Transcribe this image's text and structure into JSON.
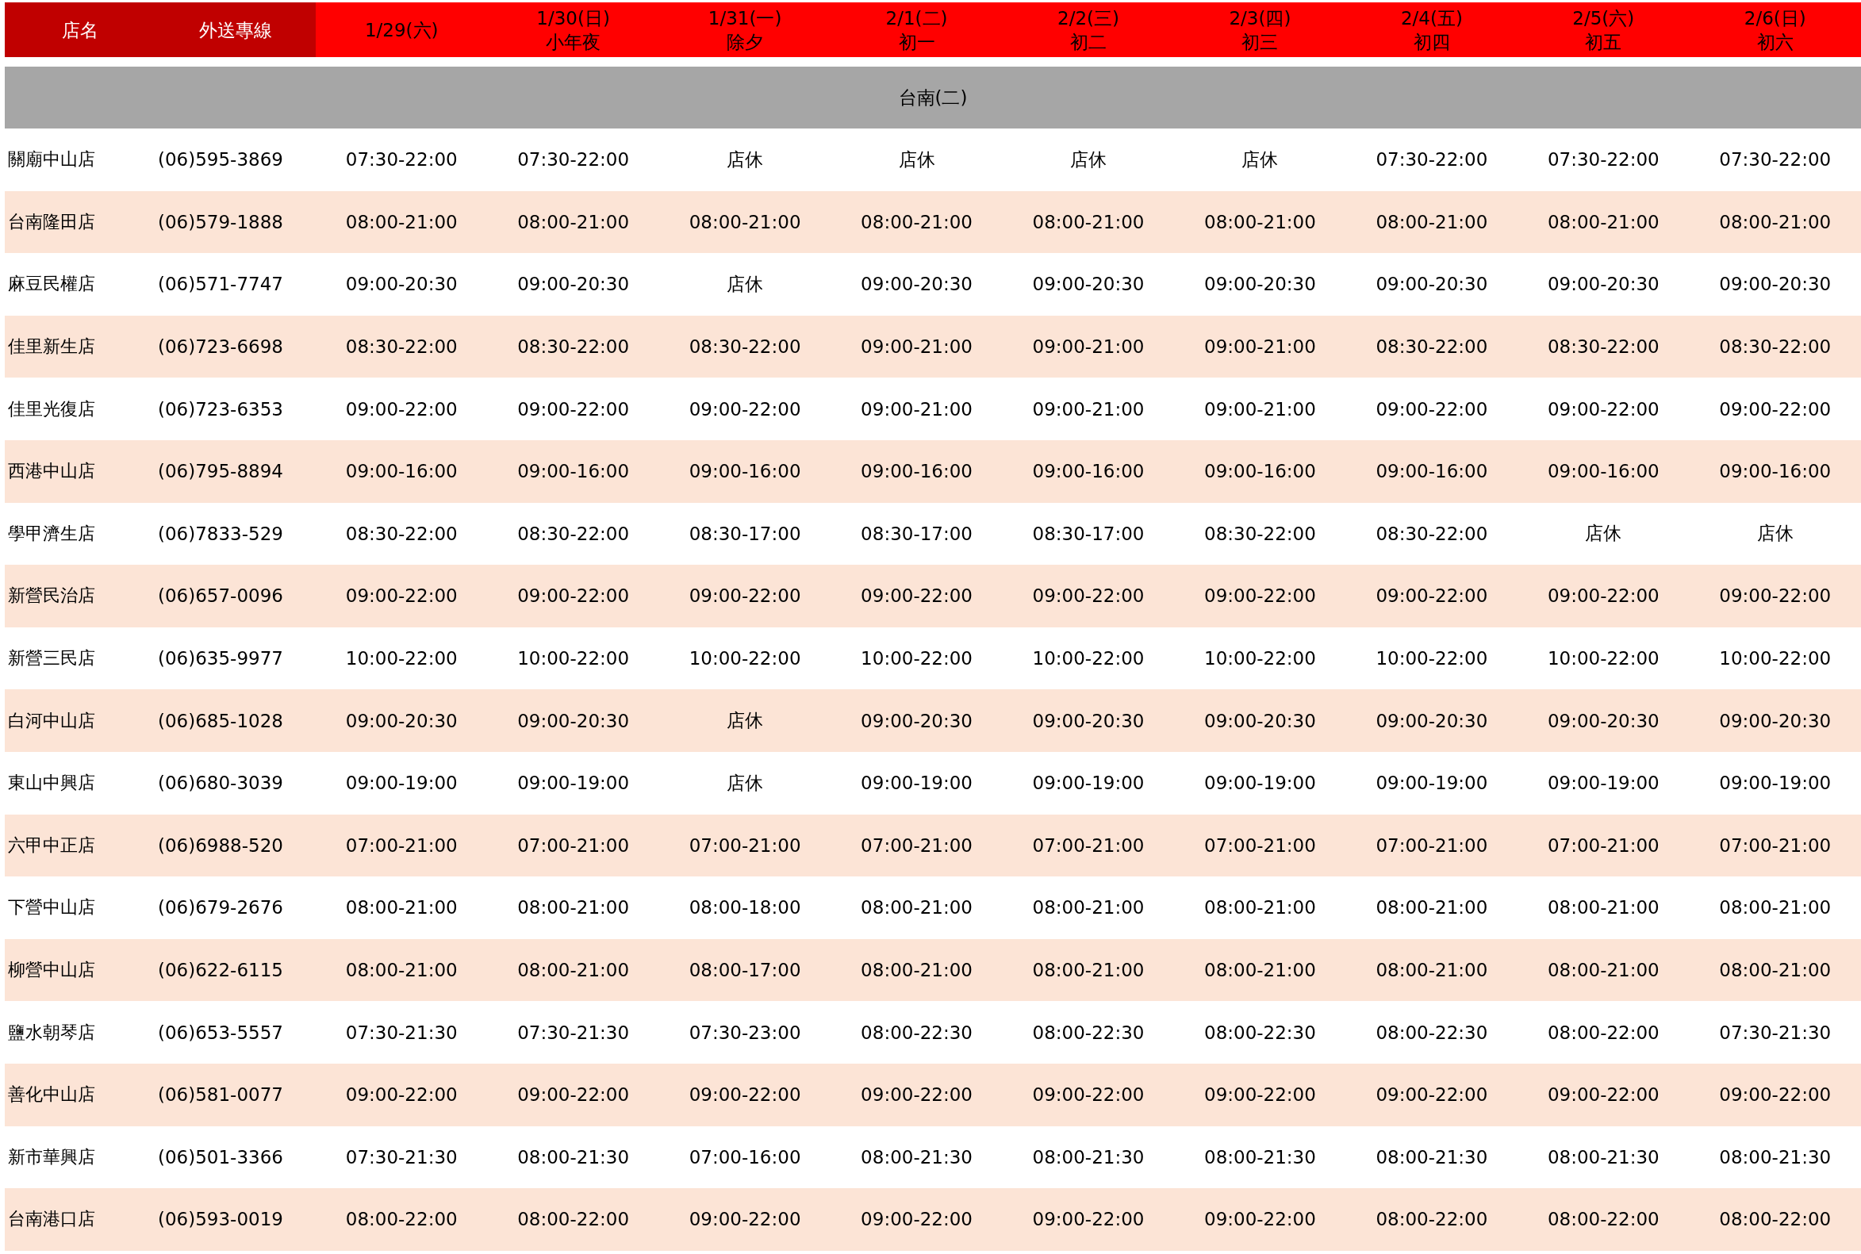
{
  "columns": [
    {
      "date": "店名"
    },
    {
      "date": "外送專線"
    },
    {
      "date": "1/29(六)"
    },
    {
      "date": "1/30(日)",
      "note": "小年夜"
    },
    {
      "date": "1/31(一)",
      "note": "除夕"
    },
    {
      "date": "2/1(二)",
      "note": "初一"
    },
    {
      "date": "2/2(三)",
      "note": "初二"
    },
    {
      "date": "2/3(四)",
      "note": "初三"
    },
    {
      "date": "2/4(五)",
      "note": "初四"
    },
    {
      "date": "2/5(六)",
      "note": "初五"
    },
    {
      "date": "2/6(日)",
      "note": "初六"
    }
  ],
  "region": "台南(二)",
  "rows": [
    {
      "name": "關廟中山店",
      "phone": "(06)595-3869",
      "hours": [
        "07:30-22:00",
        "07:30-22:00",
        "店休",
        "店休",
        "店休",
        "店休",
        "07:30-22:00",
        "07:30-22:00",
        "07:30-22:00"
      ]
    },
    {
      "name": "台南隆田店",
      "phone": "(06)579-1888",
      "hours": [
        "08:00-21:00",
        "08:00-21:00",
        "08:00-21:00",
        "08:00-21:00",
        "08:00-21:00",
        "08:00-21:00",
        "08:00-21:00",
        "08:00-21:00",
        "08:00-21:00"
      ]
    },
    {
      "name": "麻豆民權店",
      "phone": "(06)571-7747",
      "hours": [
        "09:00-20:30",
        "09:00-20:30",
        "店休",
        "09:00-20:30",
        "09:00-20:30",
        "09:00-20:30",
        "09:00-20:30",
        "09:00-20:30",
        "09:00-20:30"
      ]
    },
    {
      "name": "佳里新生店",
      "phone": "(06)723-6698",
      "hours": [
        "08:30-22:00",
        "08:30-22:00",
        "08:30-22:00",
        "09:00-21:00",
        "09:00-21:00",
        "09:00-21:00",
        "08:30-22:00",
        "08:30-22:00",
        "08:30-22:00"
      ]
    },
    {
      "name": "佳里光復店",
      "phone": "(06)723-6353",
      "hours": [
        "09:00-22:00",
        "09:00-22:00",
        "09:00-22:00",
        "09:00-21:00",
        "09:00-21:00",
        "09:00-21:00",
        "09:00-22:00",
        "09:00-22:00",
        "09:00-22:00"
      ]
    },
    {
      "name": "西港中山店",
      "phone": "(06)795-8894",
      "hours": [
        "09:00-16:00",
        "09:00-16:00",
        "09:00-16:00",
        "09:00-16:00",
        "09:00-16:00",
        "09:00-16:00",
        "09:00-16:00",
        "09:00-16:00",
        "09:00-16:00"
      ]
    },
    {
      "name": "學甲濟生店",
      "phone": "(06)7833-529",
      "hours": [
        "08:30-22:00",
        "08:30-22:00",
        "08:30-17:00",
        "08:30-17:00",
        "08:30-17:00",
        "08:30-22:00",
        "08:30-22:00",
        "店休",
        "店休"
      ]
    },
    {
      "name": "新營民治店",
      "phone": "(06)657-0096",
      "hours": [
        "09:00-22:00",
        "09:00-22:00",
        "09:00-22:00",
        "09:00-22:00",
        "09:00-22:00",
        "09:00-22:00",
        "09:00-22:00",
        "09:00-22:00",
        "09:00-22:00"
      ]
    },
    {
      "name": "新營三民店",
      "phone": "(06)635-9977",
      "hours": [
        "10:00-22:00",
        "10:00-22:00",
        "10:00-22:00",
        "10:00-22:00",
        "10:00-22:00",
        "10:00-22:00",
        "10:00-22:00",
        "10:00-22:00",
        "10:00-22:00"
      ]
    },
    {
      "name": "白河中山店",
      "phone": "(06)685-1028",
      "hours": [
        "09:00-20:30",
        "09:00-20:30",
        "店休",
        "09:00-20:30",
        "09:00-20:30",
        "09:00-20:30",
        "09:00-20:30",
        "09:00-20:30",
        "09:00-20:30"
      ]
    },
    {
      "name": "東山中興店",
      "phone": "(06)680-3039",
      "hours": [
        "09:00-19:00",
        "09:00-19:00",
        "店休",
        "09:00-19:00",
        "09:00-19:00",
        "09:00-19:00",
        "09:00-19:00",
        "09:00-19:00",
        "09:00-19:00"
      ]
    },
    {
      "name": "六甲中正店",
      "phone": "(06)6988-520",
      "hours": [
        "07:00-21:00",
        "07:00-21:00",
        "07:00-21:00",
        "07:00-21:00",
        "07:00-21:00",
        "07:00-21:00",
        "07:00-21:00",
        "07:00-21:00",
        "07:00-21:00"
      ]
    },
    {
      "name": "下營中山店",
      "phone": "(06)679-2676",
      "hours": [
        "08:00-21:00",
        "08:00-21:00",
        "08:00-18:00",
        "08:00-21:00",
        "08:00-21:00",
        "08:00-21:00",
        "08:00-21:00",
        "08:00-21:00",
        "08:00-21:00"
      ]
    },
    {
      "name": "柳營中山店",
      "phone": "(06)622-6115",
      "hours": [
        "08:00-21:00",
        "08:00-21:00",
        "08:00-17:00",
        "08:00-21:00",
        "08:00-21:00",
        "08:00-21:00",
        "08:00-21:00",
        "08:00-21:00",
        "08:00-21:00"
      ]
    },
    {
      "name": "鹽水朝琴店",
      "phone": "(06)653-5557",
      "hours": [
        "07:30-21:30",
        "07:30-21:30",
        "07:30-23:00",
        "08:00-22:30",
        "08:00-22:30",
        "08:00-22:30",
        "08:00-22:30",
        "08:00-22:00",
        "07:30-21:30"
      ]
    },
    {
      "name": "善化中山店",
      "phone": "(06)581-0077",
      "hours": [
        "09:00-22:00",
        "09:00-22:00",
        "09:00-22:00",
        "09:00-22:00",
        "09:00-22:00",
        "09:00-22:00",
        "09:00-22:00",
        "09:00-22:00",
        "09:00-22:00"
      ]
    },
    {
      "name": "新市華興店",
      "phone": "(06)501-3366",
      "hours": [
        "07:30-21:30",
        "08:00-21:30",
        "07:00-16:00",
        "08:00-21:30",
        "08:00-21:30",
        "08:00-21:30",
        "08:00-21:30",
        "08:00-21:30",
        "08:00-21:30"
      ]
    },
    {
      "name": "台南港口店",
      "phone": "(06)593-0019",
      "hours": [
        "08:00-22:00",
        "08:00-22:00",
        "09:00-22:00",
        "09:00-22:00",
        "09:00-22:00",
        "09:00-22:00",
        "08:00-22:00",
        "08:00-22:00",
        "08:00-22:00"
      ]
    }
  ]
}
